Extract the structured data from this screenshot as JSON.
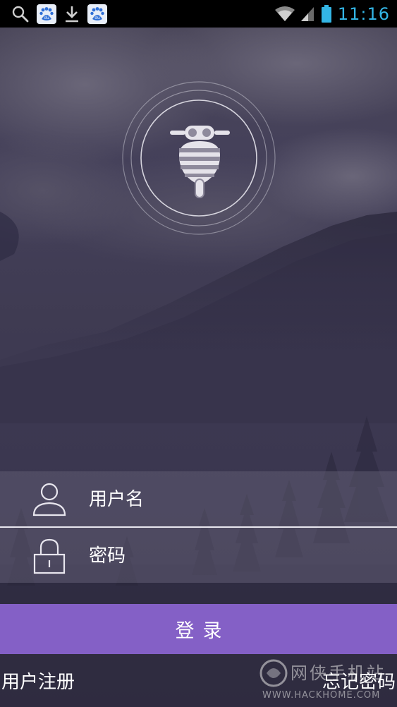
{
  "status_bar": {
    "left_icons": [
      "search-icon",
      "baidu-icon",
      "download-icon",
      "baidu-icon"
    ],
    "right_icons": [
      "wifi-icon",
      "signal-icon",
      "battery-icon"
    ],
    "time": "11:16",
    "time_color": "#33b5e5"
  },
  "logo": {
    "icon": "bee-logo-icon"
  },
  "login_form": {
    "username": {
      "icon": "user-icon",
      "placeholder": "用户名",
      "value": ""
    },
    "password": {
      "icon": "lock-icon",
      "placeholder": "密码",
      "value": ""
    },
    "submit_label": "登录",
    "accent_color": "#8460c6"
  },
  "footer": {
    "register_label": "用户注册",
    "forgot_label": "忘记密码"
  },
  "watermark": {
    "text_cn": "网侠手机站",
    "text_en": "WWW.HACKHOME.COM"
  }
}
